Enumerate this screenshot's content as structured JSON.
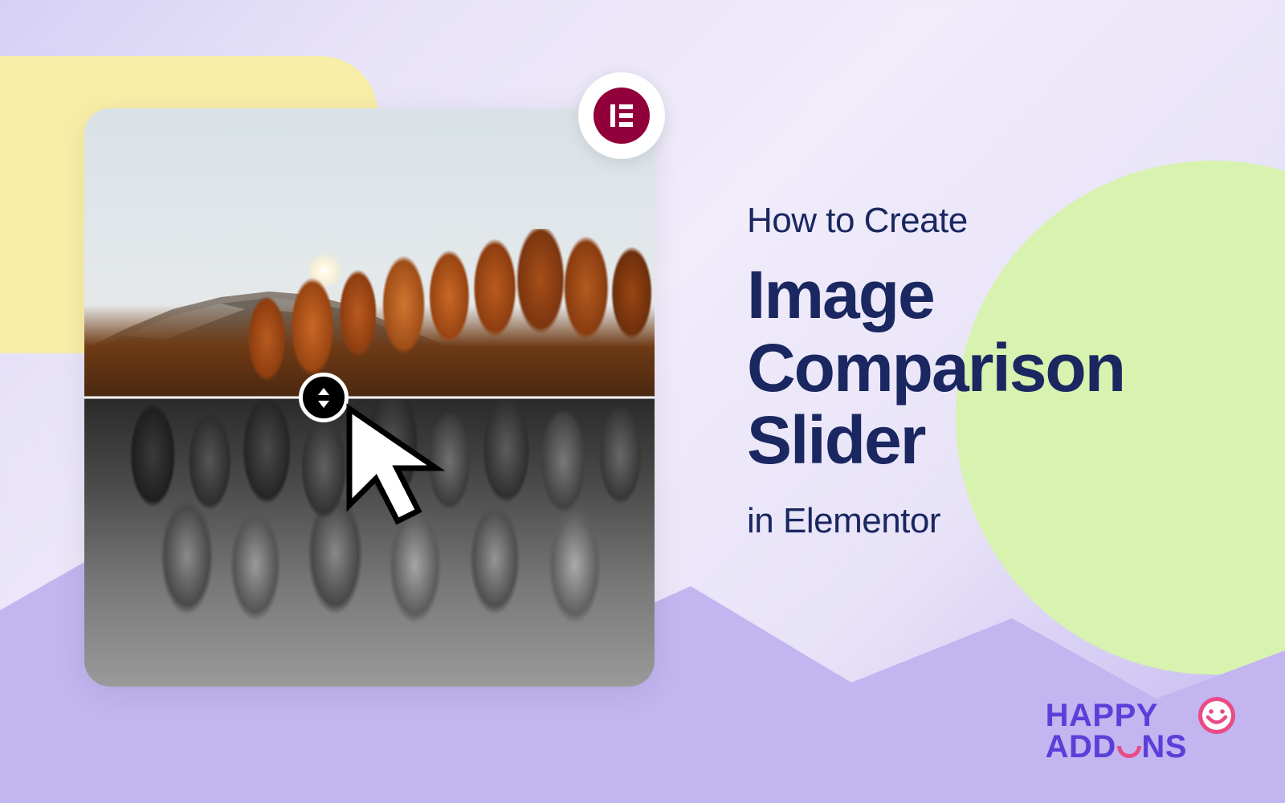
{
  "text": {
    "eyebrow": "How to Create",
    "title": "Image Comparison Slider",
    "sub": "in Elementor"
  },
  "logo": {
    "line1": "HAPPY",
    "line2_prefix": "ADD",
    "line2_o": "O",
    "line2_suffix": "NS"
  },
  "colors": {
    "title": "#1a2760",
    "brand": "#5b3fd9",
    "accent_pink": "#e94b86",
    "elementor": "#92003b"
  }
}
